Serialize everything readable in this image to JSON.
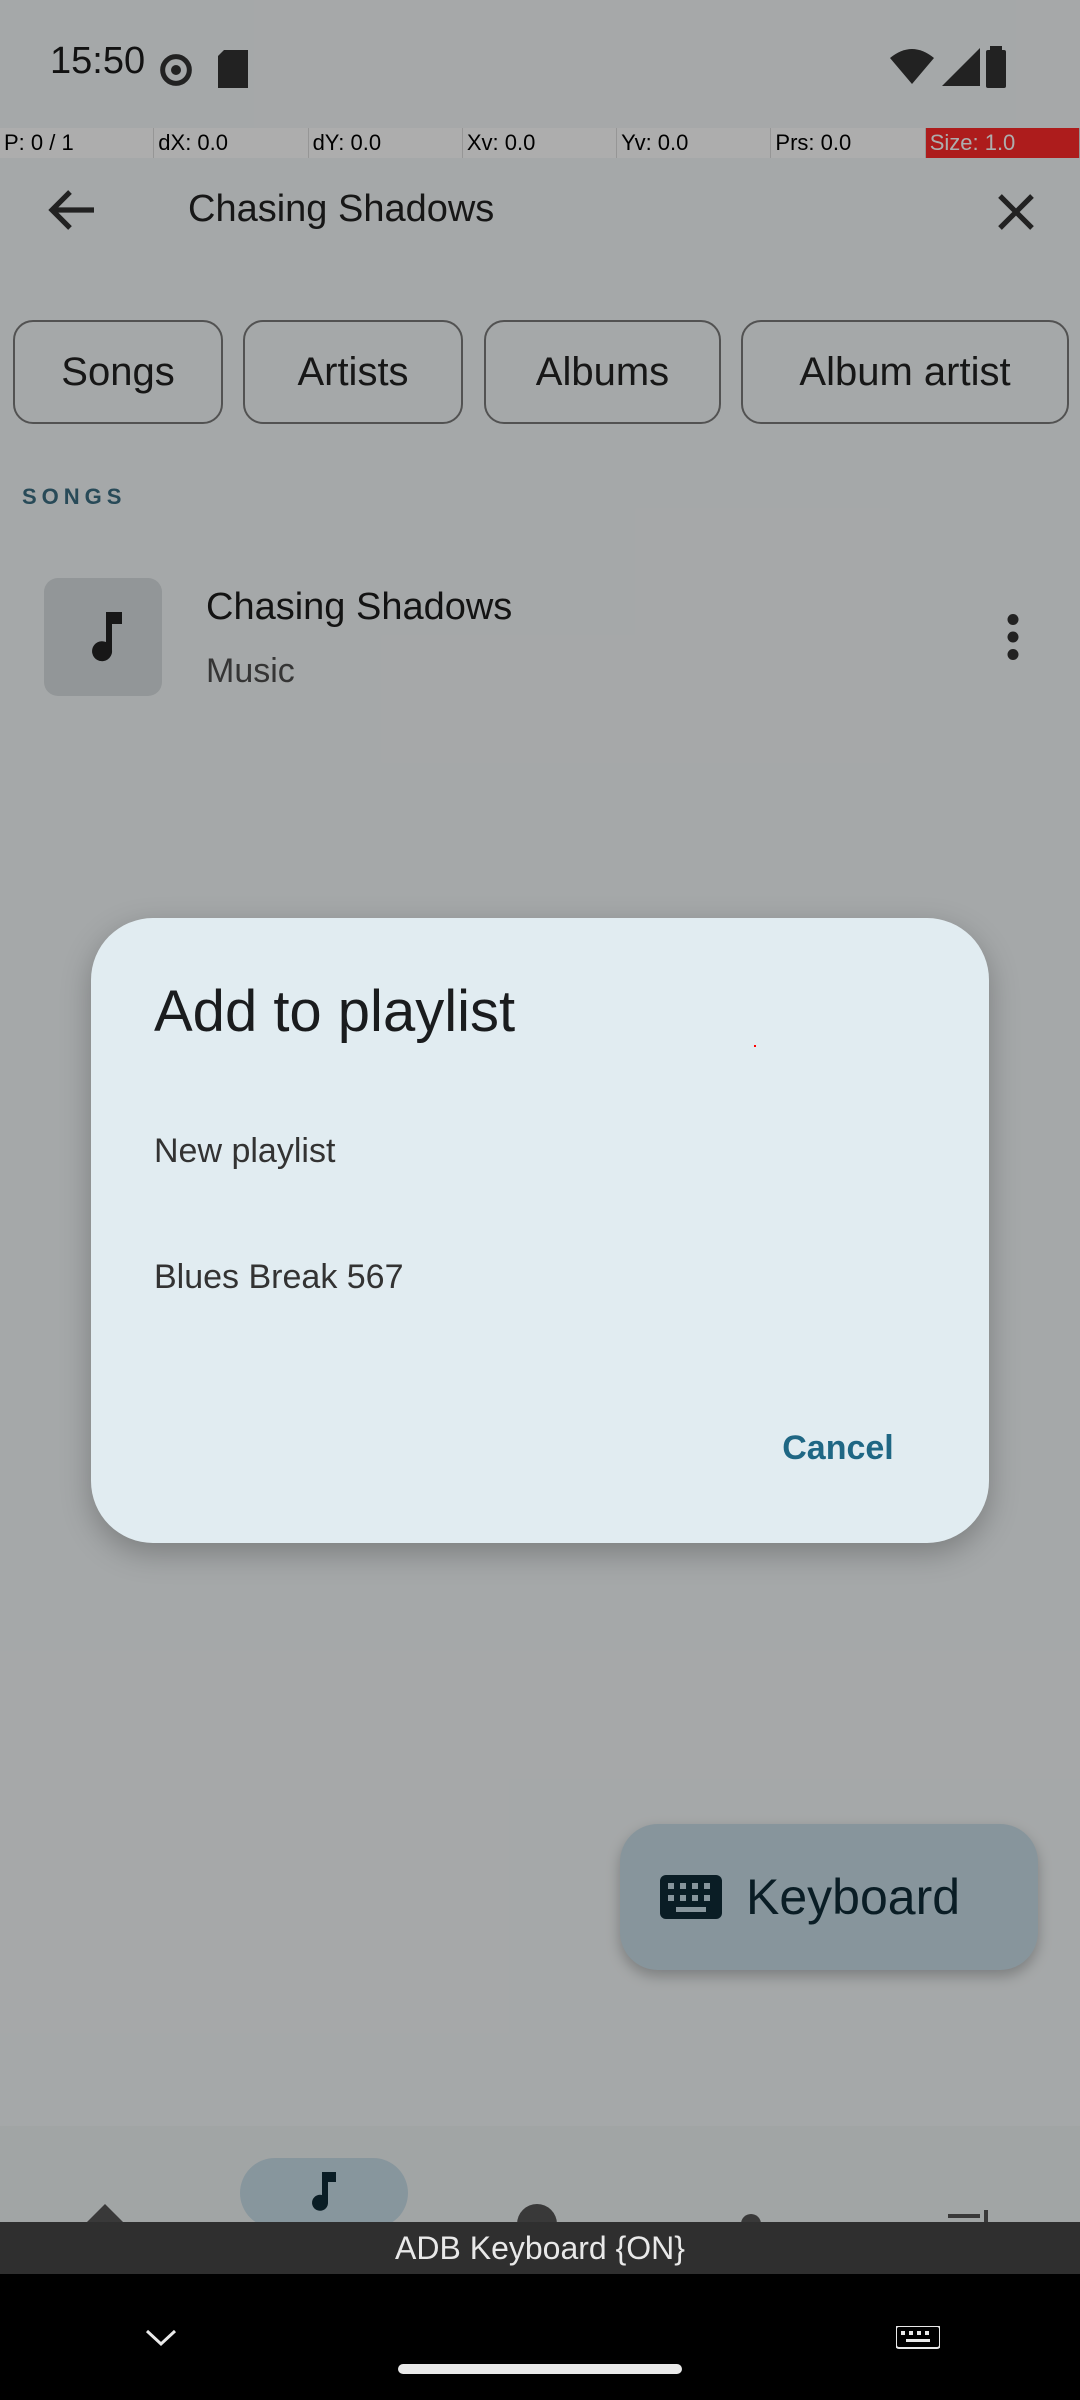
{
  "status_bar": {
    "time": "15:50"
  },
  "pointer_overlay": {
    "p": "P: 0 / 1",
    "dx": "dX: 0.0",
    "dy": "dY: 0.0",
    "xv": "Xv: 0.0",
    "yv": "Yv: 0.0",
    "prs": "Prs: 0.0",
    "size": "Size: 1.0"
  },
  "search": {
    "query": "Chasing Shadows"
  },
  "filters": [
    "Songs",
    "Artists",
    "Albums",
    "Album artist"
  ],
  "section": {
    "label": "SONGS"
  },
  "song": {
    "title": "Chasing Shadows",
    "subtitle": "Music"
  },
  "fab": {
    "label": "Keyboard"
  },
  "keyboard_indicator": {
    "text": "ADB Keyboard {ON}"
  },
  "dialog": {
    "title": "Add to playlist",
    "items": [
      "New playlist",
      "Blues Break 567"
    ],
    "cancel_label": "Cancel"
  }
}
